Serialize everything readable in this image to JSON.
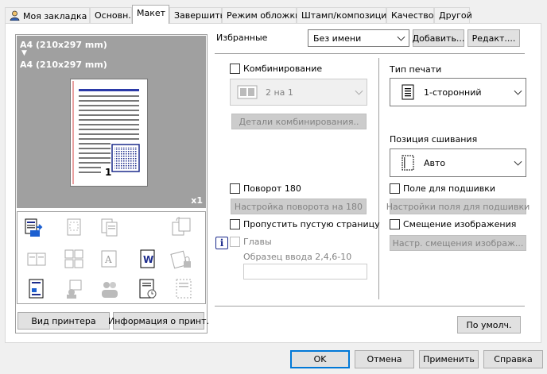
{
  "tabs": [
    {
      "label": "Моя закладка",
      "icon": "user-icon"
    },
    {
      "label": "Основн."
    },
    {
      "label": "Макет"
    },
    {
      "label": "Завершить"
    },
    {
      "label": "Режим обложки"
    },
    {
      "label": "Штамп/композиция"
    },
    {
      "label": "Качество"
    },
    {
      "label": "Другой"
    }
  ],
  "preview": {
    "paper_from": "A4 (210x297 mm)",
    "arrow": "▼",
    "paper_to": "A4 (210x297 mm)",
    "copies": "x1",
    "page_number": "1"
  },
  "left_buttons": {
    "printer_view": "Вид принтера",
    "printer_info": "Информация о принт."
  },
  "favorites": {
    "label": "Избранные",
    "value": "Без имени",
    "add": "Добавить...",
    "edit": "Редакт...."
  },
  "combine": {
    "label": "Комбинирование",
    "value": "2 на 1",
    "details": "Детали комбинирования.."
  },
  "rotate": {
    "label": "Поворот 180",
    "settings": "Настройка поворота на 180"
  },
  "skip_blank": {
    "label": "Пропустить пустую страницу"
  },
  "chapters": {
    "label": "Главы",
    "hint": "Образец ввода 2,4,6-10",
    "value": ""
  },
  "print_type": {
    "label": "Тип печати",
    "value": "1-сторонний"
  },
  "binding": {
    "label": "Позиция сшивания",
    "value": "Авто"
  },
  "binding_margin": {
    "label": "Поле для подшивки",
    "settings": "Настройки поля для подшивки"
  },
  "image_shift": {
    "label": "Смещение изображения",
    "settings": "Настр. смещения изображ..."
  },
  "default_button": "По умолч.",
  "dialog": {
    "ok": "OK",
    "cancel": "Отмена",
    "apply": "Применить",
    "help": "Справка"
  },
  "colors": {
    "accent": "#0078d7",
    "preview_bg": "#a0a0a0",
    "icon_blue": "#0a3d91"
  }
}
